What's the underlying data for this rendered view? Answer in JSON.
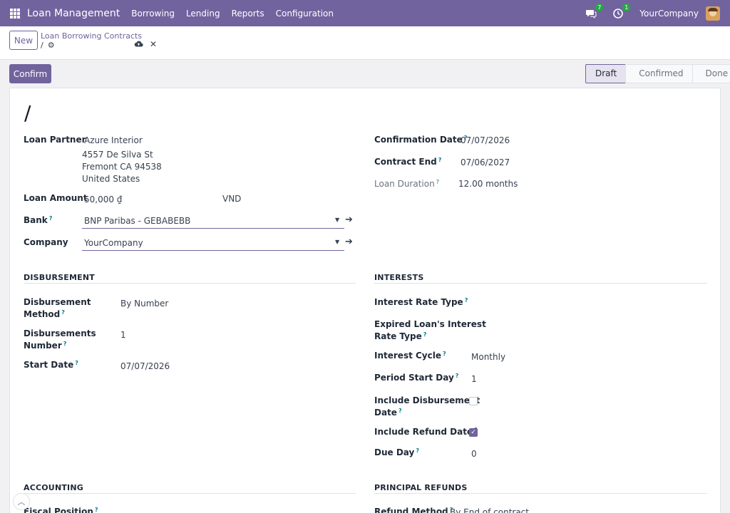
{
  "navbar": {
    "app_title": "Loan Management",
    "menu": [
      "Borrowing",
      "Lending",
      "Reports",
      "Configuration"
    ],
    "messages_count": "7",
    "activities_count": "1",
    "company": "YourCompany"
  },
  "control": {
    "new_label": "New",
    "breadcrumb_parent": "Loan Borrowing Contracts",
    "breadcrumb_current": "/"
  },
  "statusbar": {
    "confirm_label": "Confirm",
    "stages": [
      "Draft",
      "Confirmed",
      "Done"
    ],
    "active_stage": "Draft"
  },
  "form": {
    "record_name": "/",
    "loan_partner_label": "Loan Partner",
    "loan_partner": "Azure Interior",
    "address_lines": [
      "4557 De Silva St",
      "Fremont CA 94538",
      "United States"
    ],
    "loan_amount_label": "Loan Amount",
    "loan_amount": "50,000 ₫",
    "currency": "VND",
    "bank_label": "Bank",
    "bank": "BNP Paribas - GEBABEBB",
    "company_label": "Company",
    "company": "YourCompany",
    "confirmation_date_label": "Confirmation Date",
    "confirmation_date": "07/07/2026",
    "contract_end_label": "Contract End",
    "contract_end": "07/06/2027",
    "loan_duration_label": "Loan Duration",
    "loan_duration": "12.00 months",
    "q": "?"
  },
  "disbursement": {
    "title": "DISBURSEMENT",
    "method_label_1": "Disbursement",
    "method_label_2": "Method",
    "method": "By Number",
    "number_label_1": "Disbursements",
    "number_label_2": "Number",
    "number": "1",
    "start_date_label": "Start Date",
    "start_date": "07/07/2026"
  },
  "interests": {
    "title": "INTERESTS",
    "rate_type_label": "Interest Rate Type",
    "expired_label_1": "Expired Loan's Interest",
    "expired_label_2": "Rate Type",
    "cycle_label": "Interest Cycle",
    "cycle": "Monthly",
    "period_start_label": "Period Start Day",
    "period_start": "1",
    "include_disb_label_1": "Include Disbursement",
    "include_disb_label_2": "Date",
    "include_disb_checked": false,
    "include_refund_label": "Include Refund Date",
    "include_refund_checked": true,
    "due_day_label": "Due Day",
    "due_day": "0"
  },
  "accounting": {
    "title": "ACCOUNTING",
    "fiscal_position_label": "Fiscal Position"
  },
  "principal_refunds": {
    "title": "PRINCIPAL REFUNDS",
    "refund_method_label": "Refund Method",
    "refund_method": "By End of contract"
  }
}
